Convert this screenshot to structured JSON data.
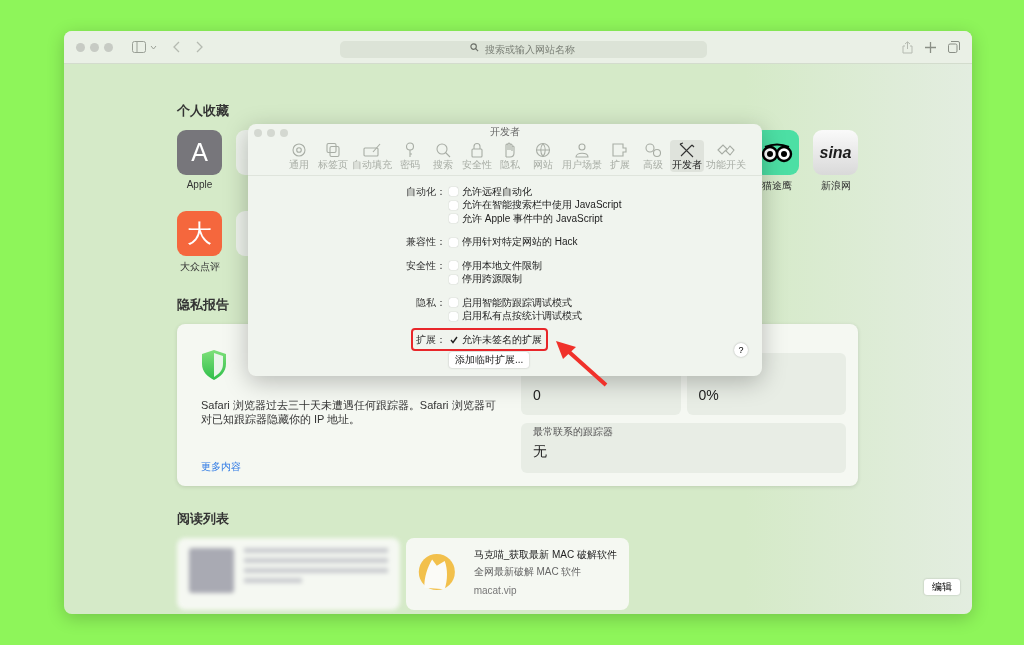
{
  "toolbar": {
    "address_placeholder": "搜索或输入网站名称"
  },
  "favorites": {
    "title": "个人收藏",
    "rows": [
      [
        {
          "kind": "letter",
          "glyph": "A",
          "label": "Apple"
        },
        {
          "kind": "partial"
        },
        {
          "kind": "spacer"
        },
        {
          "kind": "tripadvisor",
          "label": "猫途鹰"
        },
        {
          "kind": "sina",
          "glyph": "sina",
          "label": "新浪网"
        }
      ],
      [
        {
          "kind": "orange",
          "glyph": "大",
          "label": "大众点评"
        },
        {
          "kind": "partial"
        }
      ]
    ]
  },
  "preferences": {
    "title": "开发者",
    "tabs": [
      {
        "label": "通用",
        "selected": false
      },
      {
        "label": "标签页",
        "selected": false
      },
      {
        "label": "自动填充",
        "selected": false
      },
      {
        "label": "密码",
        "selected": false
      },
      {
        "label": "搜索",
        "selected": false
      },
      {
        "label": "安全性",
        "selected": false
      },
      {
        "label": "隐私",
        "selected": false
      },
      {
        "label": "网站",
        "selected": false
      },
      {
        "label": "用户场景",
        "selected": false
      },
      {
        "label": "扩展",
        "selected": false
      },
      {
        "label": "高级",
        "selected": false
      },
      {
        "label": "开发者",
        "selected": true
      },
      {
        "label": "功能开关",
        "selected": false
      }
    ],
    "groups": [
      {
        "label": "自动化：",
        "highlighted": false,
        "options": [
          {
            "label": "允许远程自动化",
            "checked": false
          },
          {
            "label": "允许在智能搜索栏中使用 JavaScript",
            "checked": false
          },
          {
            "label": "允许 Apple 事件中的 JavaScript",
            "checked": false
          }
        ]
      },
      {
        "label": "兼容性：",
        "highlighted": false,
        "options": [
          {
            "label": "停用针对特定网站的 Hack",
            "checked": false
          }
        ]
      },
      {
        "label": "安全性：",
        "highlighted": false,
        "options": [
          {
            "label": "停用本地文件限制",
            "checked": false
          },
          {
            "label": "停用跨源限制",
            "checked": false
          }
        ]
      },
      {
        "label": "隐私：",
        "highlighted": false,
        "options": [
          {
            "label": "启用智能防跟踪调试模式",
            "checked": false
          },
          {
            "label": "启用私有点按统计调试模式",
            "checked": false
          }
        ]
      },
      {
        "label": "扩展：",
        "highlighted": true,
        "options": [
          {
            "label": "允许未签名的扩展",
            "checked": true
          }
        ]
      }
    ],
    "temp_button": "添加临时扩展...",
    "help": "?"
  },
  "privacy": {
    "title": "隐私报告",
    "message": "Safari 浏览器过去三十天未遭遇任何跟踪器。Safari 浏览器可对已知跟踪器隐藏你的 IP 地址。",
    "link": "更多内容",
    "stats": [
      {
        "value": "0"
      },
      {
        "value": "0%"
      },
      {
        "label": "最常联系的跟踪器",
        "value": "无"
      }
    ]
  },
  "reading_list": {
    "title": "阅读列表",
    "items": [
      {
        "kind": "blurred"
      },
      {
        "kind": "article",
        "title": "马克喵_获取最新 MAC 破解软件",
        "description": "全网最新破解 MAC 软件",
        "site": "macat.vip"
      }
    ],
    "edit_button": "编辑"
  }
}
